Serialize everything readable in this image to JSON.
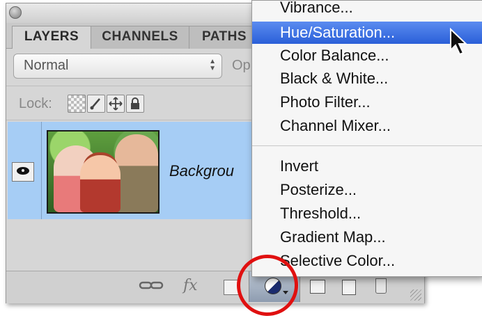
{
  "panel": {
    "tabs": [
      {
        "label": "LAYERS",
        "active": true
      },
      {
        "label": "CHANNELS",
        "active": false
      },
      {
        "label": "PATHS",
        "active": false
      }
    ],
    "blend_mode": "Normal",
    "opacity_label": "Op",
    "lock_label": "Lock:",
    "layer": {
      "name": "Backgrou",
      "visible": true
    }
  },
  "bottom_bar": {
    "fx_label": "fx"
  },
  "menu": {
    "items": [
      {
        "label": "Vibrance...",
        "highlighted": false
      },
      {
        "label": "Hue/Saturation...",
        "highlighted": true
      },
      {
        "label": "Color Balance...",
        "highlighted": false
      },
      {
        "label": "Black & White...",
        "highlighted": false
      },
      {
        "label": "Photo Filter...",
        "highlighted": false
      },
      {
        "label": "Channel Mixer...",
        "highlighted": false
      },
      {
        "label": "Invert",
        "highlighted": false
      },
      {
        "label": "Posterize...",
        "highlighted": false
      },
      {
        "label": "Threshold...",
        "highlighted": false
      },
      {
        "label": "Gradient Map...",
        "highlighted": false
      },
      {
        "label": "Selective Color...",
        "highlighted": false
      }
    ]
  },
  "colors": {
    "highlight": "#2a5fd8",
    "layer_selected": "#a6cdf5",
    "annotation": "#e01010"
  }
}
